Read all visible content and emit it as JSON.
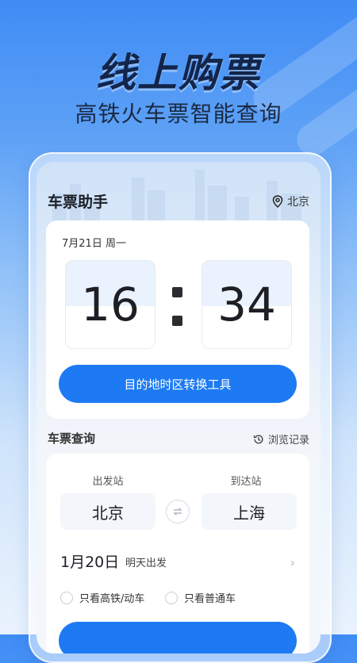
{
  "promo": {
    "headline": "线上购票",
    "subheadline": "高铁火车票智能查询"
  },
  "header": {
    "app_title": "车票助手",
    "location": "北京",
    "location_icon": "location-pin-icon"
  },
  "clock": {
    "date": "7月21日  周一",
    "hours": "16",
    "minutes": "34"
  },
  "timezone_button": {
    "label": "目的地时区转换工具"
  },
  "ticket_query": {
    "section_title": "车票查询",
    "history_label": "浏览记录",
    "history_icon": "history-clock-icon",
    "from_label": "出发站",
    "to_label": "到达站",
    "from_station": "北京",
    "to_station": "上海",
    "swap_icon": "swap-arrows-icon",
    "date": "1月20日",
    "date_hint": "明天出发",
    "filters": [
      {
        "label": "只看高铁/动车",
        "checked": false
      },
      {
        "label": "只看普通车",
        "checked": false
      }
    ]
  },
  "colors": {
    "accent": "#1d7af3",
    "headline": "#13254a"
  }
}
